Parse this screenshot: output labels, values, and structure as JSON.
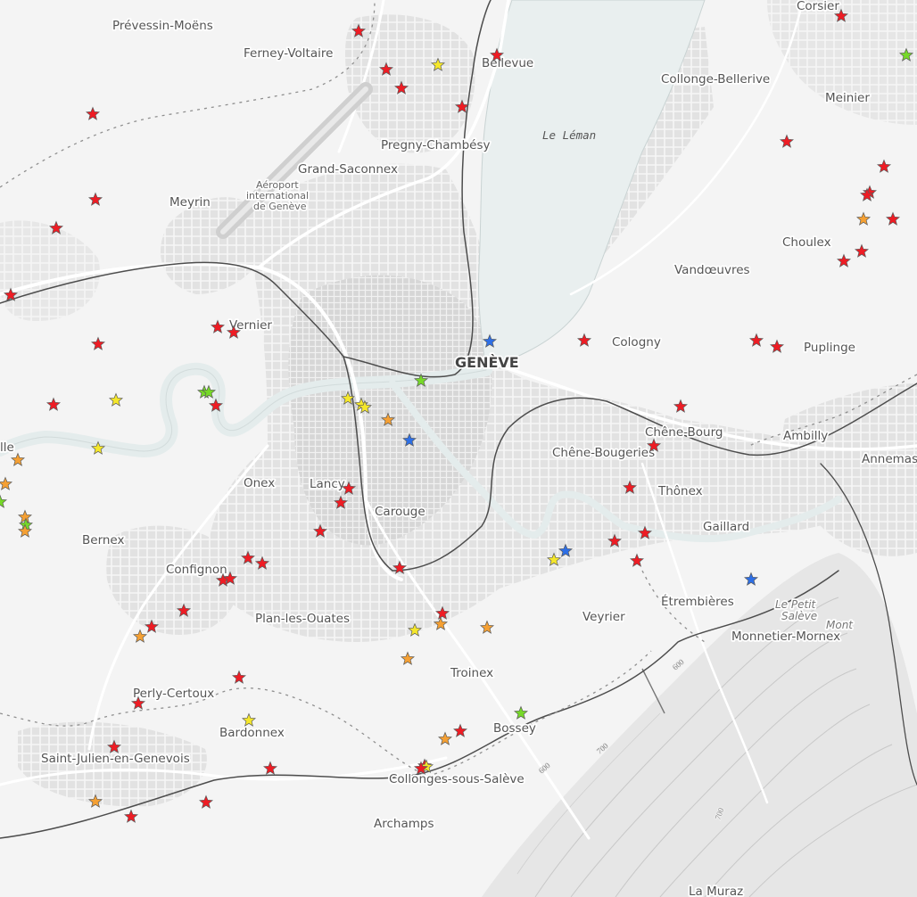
{
  "colors": {
    "land": "#f4f4f4",
    "water": "#e9efef",
    "urban": "#dcdcdc",
    "roads": "#ffffff",
    "rail": "#555555",
    "border": "#9a9a9a",
    "red": "#ee1c24",
    "yellow": "#f5e72a",
    "orange": "#f5a033",
    "green": "#76d928",
    "blue": "#2d6fe6"
  },
  "labels": {
    "prevessin": "Prévessin-Moëns",
    "ferney": "Ferney-Voltaire",
    "bellevue": "Bellevue",
    "corsier": "Corsier",
    "collonge_bellerive": "Collonge-Bellerive",
    "meinier": "Meinier",
    "le_leman": "Le Léman",
    "pregny": "Pregny-Chambésy",
    "grand_saconnex": "Grand-Saconnex",
    "aeroport_1": "Aéroport",
    "aeroport_2": "international",
    "aeroport_3": "de Genève",
    "meyrin": "Meyrin",
    "choulex": "Choulex",
    "vandoeuvres": "Vandœuvres",
    "vernier": "Vernier",
    "geneve": "GENÈVE",
    "cologny": "Cologny",
    "puplinge": "Puplinge",
    "chene_bourg": "Chêne-Bourg",
    "ambilly": "Ambilly",
    "chene_bougeries": "Chêne-Bougeries",
    "annemasse": "Annemas",
    "thonex": "Thônex",
    "onex": "Onex",
    "lancy": "Lancy",
    "carouge": "Carouge",
    "gaillard": "Gaillard",
    "bernex": "Bernex",
    "confignon": "Confignon",
    "etrembieres": "Étrembières",
    "le_petit_saleve_1": "Le Petit",
    "le_petit_saleve_2": "Salève",
    "mont": "Mont",
    "plan_les_ouates": "Plan-les-Ouates",
    "veyrier": "Veyrier",
    "monnetier": "Monnetier-Mornex",
    "troinex": "Troinex",
    "perly": "Perly-Certoux",
    "bossey": "Bossey",
    "bardonnex": "Bardonnex",
    "saint_julien": "Saint-Julien-en-Genevois",
    "collonges_saleve": "Collonges-sous-Salève",
    "archamps": "Archamps",
    "la_muraz": "La Muraz",
    "edge_lle": "lle",
    "contour_600a": "600",
    "contour_600b": "600",
    "contour_700a": "700",
    "contour_700b": "700"
  },
  "markers": [
    {
      "color": "red"
    },
    {
      "color": "red"
    },
    {
      "color": "yellow"
    },
    {
      "color": "red"
    },
    {
      "color": "red"
    },
    {
      "color": "red"
    },
    {
      "color": "red"
    },
    {
      "color": "green"
    },
    {
      "color": "red"
    },
    {
      "color": "red"
    },
    {
      "color": "red"
    },
    {
      "color": "red"
    },
    {
      "color": "red"
    },
    {
      "color": "orange"
    },
    {
      "color": "red"
    },
    {
      "color": "red"
    },
    {
      "color": "red"
    },
    {
      "color": "red"
    },
    {
      "color": "red"
    },
    {
      "color": "red"
    },
    {
      "color": "red"
    },
    {
      "color": "red"
    },
    {
      "color": "red"
    },
    {
      "color": "blue"
    },
    {
      "color": "red"
    },
    {
      "color": "red"
    },
    {
      "color": "red"
    },
    {
      "color": "red"
    },
    {
      "color": "yellow"
    },
    {
      "color": "green"
    },
    {
      "color": "green"
    },
    {
      "color": "red"
    },
    {
      "color": "yellow"
    },
    {
      "color": "yellow"
    },
    {
      "color": "yellow"
    },
    {
      "color": "green"
    },
    {
      "color": "orange"
    },
    {
      "color": "blue"
    },
    {
      "color": "red"
    },
    {
      "color": "yellow"
    },
    {
      "color": "red"
    },
    {
      "color": "red"
    },
    {
      "color": "orange"
    },
    {
      "color": "orange"
    },
    {
      "color": "green"
    },
    {
      "color": "orange"
    },
    {
      "color": "green"
    },
    {
      "color": "orange"
    },
    {
      "color": "red"
    },
    {
      "color": "red"
    },
    {
      "color": "red"
    },
    {
      "color": "red"
    },
    {
      "color": "red"
    },
    {
      "color": "red"
    },
    {
      "color": "red"
    },
    {
      "color": "red"
    },
    {
      "color": "blue"
    },
    {
      "color": "yellow"
    },
    {
      "color": "red"
    },
    {
      "color": "red"
    },
    {
      "color": "red"
    },
    {
      "color": "blue"
    },
    {
      "color": "red"
    },
    {
      "color": "red"
    },
    {
      "color": "orange"
    },
    {
      "color": "red"
    },
    {
      "color": "orange"
    },
    {
      "color": "yellow"
    },
    {
      "color": "orange"
    },
    {
      "color": "orange"
    },
    {
      "color": "red"
    },
    {
      "color": "red"
    },
    {
      "color": "yellow"
    },
    {
      "color": "red"
    },
    {
      "color": "red"
    },
    {
      "color": "orange"
    },
    {
      "color": "red"
    },
    {
      "color": "red"
    },
    {
      "color": "orange"
    },
    {
      "color": "red"
    },
    {
      "color": "green"
    },
    {
      "color": "red"
    },
    {
      "color": "yellow"
    },
    {
      "color": "red"
    }
  ]
}
